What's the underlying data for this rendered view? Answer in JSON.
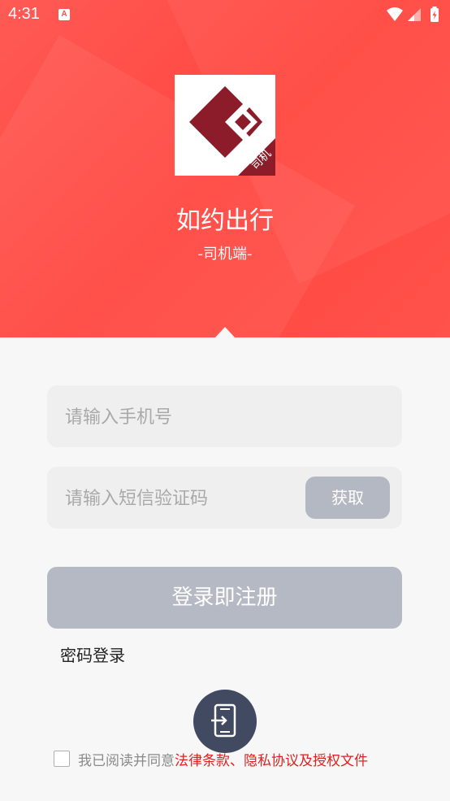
{
  "status_bar": {
    "time": "4:31",
    "a_badge": "A"
  },
  "header": {
    "app_name": "如约出行",
    "subtitle": "-司机端-",
    "logo_badge": "司机",
    "brand_color": "#ff4a44"
  },
  "form": {
    "phone_placeholder": "请输入手机号",
    "phone_value": "",
    "code_placeholder": "请输入短信验证码",
    "code_value": "",
    "get_code_label": "获取",
    "login_label": "登录即注册",
    "password_login_label": "密码登录"
  },
  "agreement": {
    "checked": false,
    "text": "我已阅读并同意",
    "link": "法律条款、隐私协议及授权文件"
  },
  "icons": {
    "switch": "phone-switch-icon"
  }
}
